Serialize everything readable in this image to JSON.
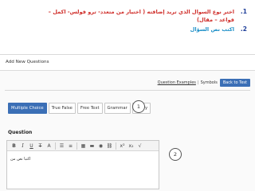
{
  "instructions": {
    "step1_number": "1.",
    "step1_line1": "اختر نوع السوال الذي تريد إضافته ( اختيار من متعدد- ترو فولس- اكمل –",
    "step1_line2": "قواعد – مقال)",
    "step2_number": "2.",
    "step2_text": "اكتب نص السؤال"
  },
  "header": {
    "title": "Add New Questions"
  },
  "toolbar": {
    "question_examples": "Question Examples",
    "separator": "|",
    "symbols": "Symbols",
    "back_to_test": "Back to Test"
  },
  "tabs": [
    {
      "label": "Multiple Choice",
      "active": true
    },
    {
      "label": "True False",
      "active": false
    },
    {
      "label": "Free Text",
      "active": false
    },
    {
      "label": "Grammar",
      "active": false
    },
    {
      "label": "Essay",
      "active": false
    }
  ],
  "callouts": {
    "one": "1",
    "two": "2"
  },
  "question": {
    "label": "Question",
    "editor_text": "اكتبا نص من"
  },
  "editor_toolbar": {
    "bold": "B",
    "italic": "I",
    "underline": "U",
    "strike": "T",
    "font_size": "A",
    "bullet_list": "☰",
    "numbered_list": "≡",
    "table": "▦",
    "image": "▬",
    "video": "◉",
    "link": "⛓",
    "superscript": "x²",
    "subscript": "x₂",
    "formula": "√"
  },
  "colors": {
    "primary_blue": "#3b6fb6",
    "instruction_red": "#d0312d",
    "instruction_number_blue": "#1f3f9a",
    "step2_blue": "#1e90c8"
  }
}
